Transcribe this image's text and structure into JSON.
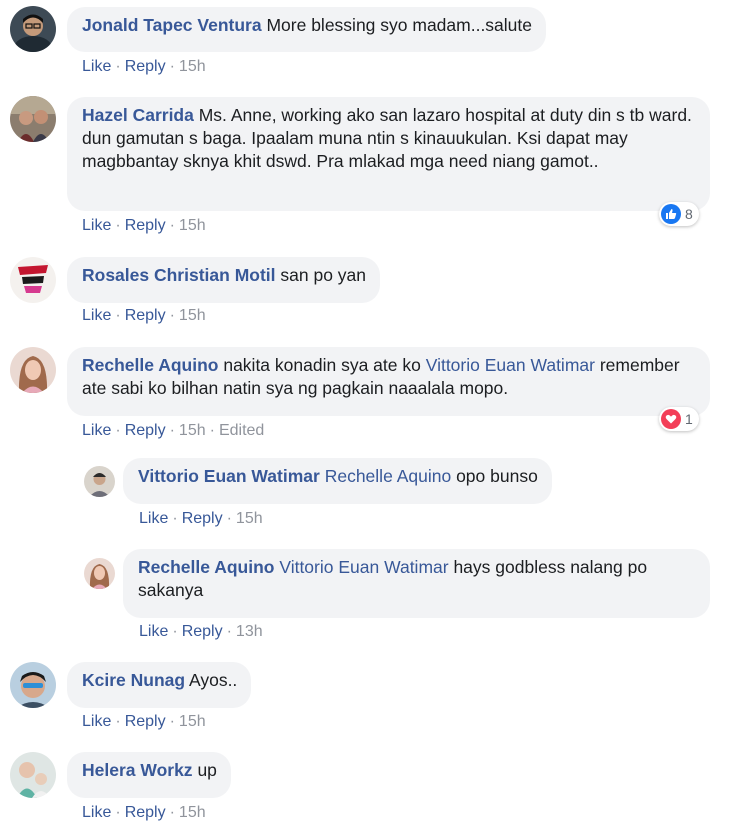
{
  "comments": [
    {
      "author": "Jonald Tapec Ventura",
      "text": "More blessing syo madam...salute",
      "actions": {
        "like": "Like",
        "reply": "Reply",
        "time": "15h"
      }
    },
    {
      "author": "Hazel Carrida",
      "text": "Ms. Anne, working ako san lazaro hospital at duty din s tb ward. dun gamutan s baga. Ipaalam muna ntin s kinauukulan. Ksi dapat may magbbantay sknya khit dswd. Pra mlakad mga need niang gamot..",
      "actions": {
        "like": "Like",
        "reply": "Reply",
        "time": "15h"
      },
      "reaction": {
        "icon": "thumbs-up-icon",
        "count": "8",
        "color": "#1877f2"
      }
    },
    {
      "author": "Rosales Christian Motil",
      "text": "san po yan",
      "actions": {
        "like": "Like",
        "reply": "Reply",
        "time": "15h"
      }
    },
    {
      "author": "Rechelle Aquino",
      "text_before": "nakita konadin sya ate ko",
      "mention": "Vittorio Euan Watimar",
      "text": "remember ate sabi ko bilhan natin sya ng pagkain naaalala mopo.",
      "actions": {
        "like": "Like",
        "reply": "Reply",
        "time": "15h",
        "edited": "Edited"
      },
      "reaction": {
        "icon": "heart-icon",
        "count": "1",
        "color": "#f33e58"
      }
    },
    {
      "author": "Kcire Nunag",
      "text": "Ayos..",
      "actions": {
        "like": "Like",
        "reply": "Reply",
        "time": "15h"
      }
    },
    {
      "author": "Helera Workz",
      "text": "up",
      "actions": {
        "like": "Like",
        "reply": "Reply",
        "time": "15h"
      }
    }
  ],
  "replies": [
    {
      "author": "Vittorio Euan Watimar",
      "mention": "Rechelle Aquino",
      "text": "opo bunso",
      "actions": {
        "like": "Like",
        "reply": "Reply",
        "time": "15h"
      }
    },
    {
      "author": "Rechelle Aquino",
      "mention": "Vittorio Euan Watimar",
      "text": "hays godbless nalang po sakanya",
      "actions": {
        "like": "Like",
        "reply": "Reply",
        "time": "13h"
      }
    }
  ],
  "colors": {
    "link": "#385898",
    "bubble": "#f2f3f5",
    "meta": "#90949c"
  }
}
